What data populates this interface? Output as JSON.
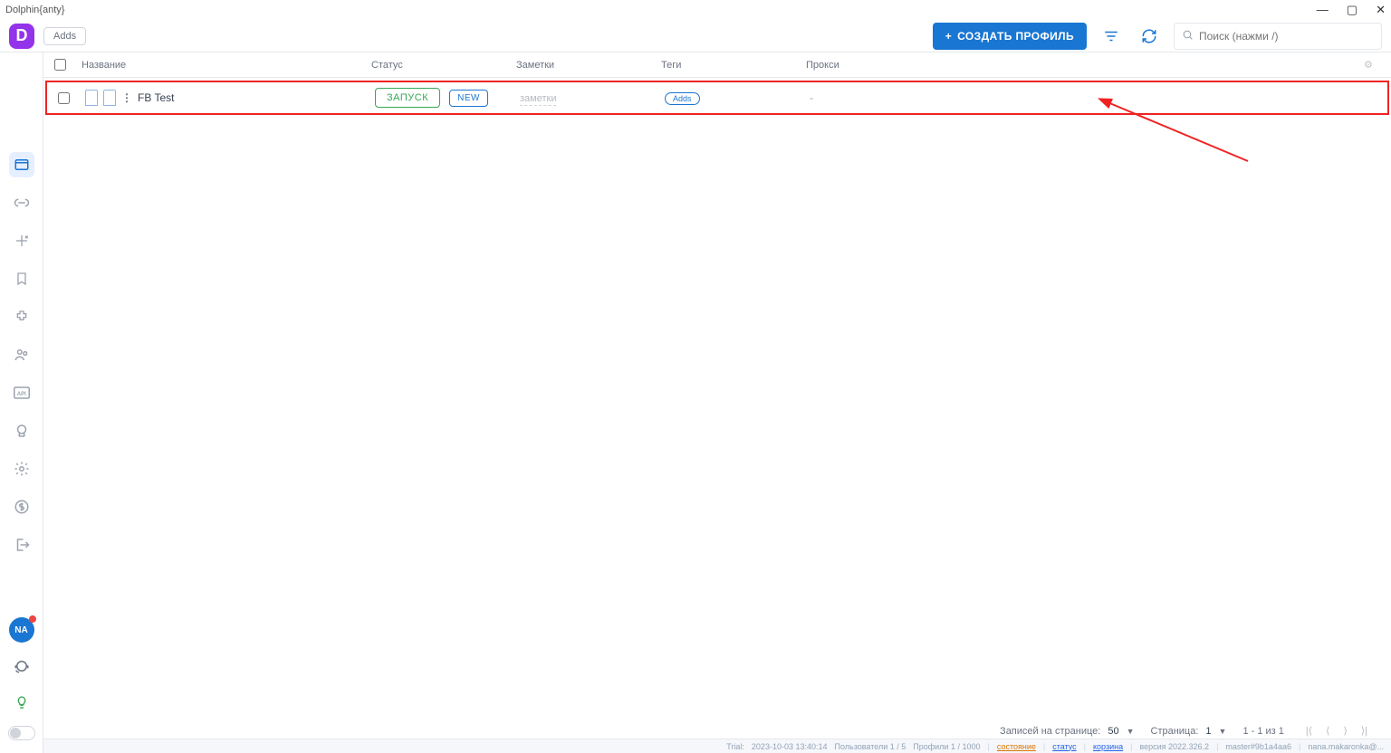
{
  "window": {
    "title": "Dolphin{anty}"
  },
  "topbar": {
    "adds_label": "Adds",
    "create_label": "СОЗДАТЬ ПРОФИЛЬ",
    "search_placeholder": "Поиск (нажми /)"
  },
  "columns": {
    "name": "Название",
    "status": "Статус",
    "notes": "Заметки",
    "tags": "Теги",
    "proxy": "Прокси"
  },
  "row": {
    "name": "FB Test",
    "run_label": "ЗАПУСК",
    "status_badge": "NEW",
    "notes_placeholder": "заметки",
    "tags_placeholder": "Adds",
    "proxy": "-"
  },
  "pager": {
    "records_label": "Записей на странице:",
    "records_value": "50",
    "page_label": "Страница:",
    "page_value": "1",
    "range": "1 - 1 из 1"
  },
  "avatar": {
    "initials": "NA"
  },
  "status": {
    "trial": "Trial:",
    "datetime": "2023-10-03 13:40:14",
    "users": "Пользователи 1 / 5",
    "profiles": "Профили 1 / 1000",
    "link_state": "состояние",
    "link_status": "статус",
    "link_trash": "корзина",
    "version": "версия 2022.326.2",
    "build": "master#9b1a4aa6",
    "user": "nana.makaronka@..."
  }
}
